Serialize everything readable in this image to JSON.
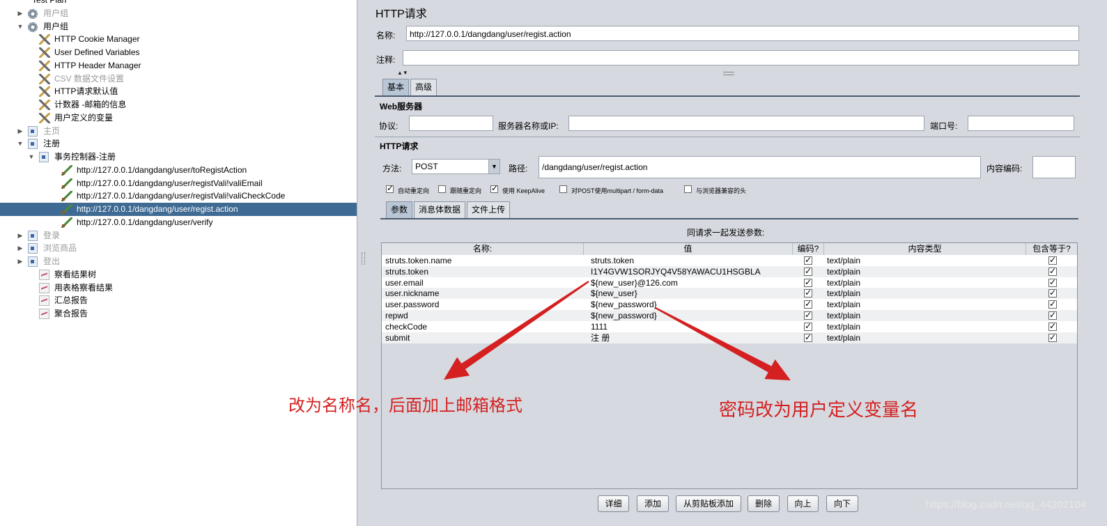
{
  "tree": {
    "items": [
      {
        "label": "Test Plan",
        "icon": "test-plan-icon",
        "toggle": "",
        "disabled": false,
        "selected": false
      },
      {
        "label": "用户组",
        "icon": "gear-icon",
        "toggle": "▶",
        "disabled": true,
        "selected": false
      },
      {
        "label": "用户组",
        "icon": "gear-icon",
        "toggle": "▼",
        "disabled": false,
        "selected": false
      },
      {
        "label": "HTTP Cookie Manager",
        "icon": "wrench-icon",
        "toggle": "",
        "disabled": false,
        "selected": false
      },
      {
        "label": "User Defined Variables",
        "icon": "wrench-icon",
        "toggle": "",
        "disabled": false,
        "selected": false
      },
      {
        "label": "HTTP Header Manager",
        "icon": "wrench-icon",
        "toggle": "",
        "disabled": false,
        "selected": false
      },
      {
        "label": "CSV 数据文件设置",
        "icon": "wrench-icon",
        "toggle": "",
        "disabled": true,
        "selected": false
      },
      {
        "label": "HTTP请求默认值",
        "icon": "wrench-icon",
        "toggle": "",
        "disabled": false,
        "selected": false
      },
      {
        "label": "计数器 -邮箱的信息",
        "icon": "wrench-icon",
        "toggle": "",
        "disabled": false,
        "selected": false
      },
      {
        "label": "用户定义的变量",
        "icon": "wrench-icon",
        "toggle": "",
        "disabled": false,
        "selected": false
      },
      {
        "label": "主页",
        "icon": "controller-icon",
        "toggle": "▶",
        "disabled": true,
        "selected": false
      },
      {
        "label": "注册",
        "icon": "controller-icon",
        "toggle": "▼",
        "disabled": false,
        "selected": false
      },
      {
        "label": "事务控制器-注册",
        "icon": "controller-icon",
        "toggle": "▼",
        "disabled": false,
        "selected": false
      },
      {
        "label": "http://127.0.0.1/dangdang/user/toRegistAction",
        "icon": "sampler-icon",
        "toggle": "",
        "disabled": false,
        "selected": false
      },
      {
        "label": "http://127.0.0.1/dangdang/user/registVali!valiEmail",
        "icon": "sampler-icon",
        "toggle": "",
        "disabled": false,
        "selected": false
      },
      {
        "label": "http://127.0.0.1/dangdang/user/registVali!valiCheckCode",
        "icon": "sampler-icon",
        "toggle": "",
        "disabled": false,
        "selected": false
      },
      {
        "label": "http://127.0.0.1/dangdang/user/regist.action",
        "icon": "sampler-icon",
        "toggle": "",
        "disabled": false,
        "selected": true
      },
      {
        "label": "http://127.0.0.1/dangdang/user/verify",
        "icon": "sampler-icon",
        "toggle": "",
        "disabled": false,
        "selected": false
      },
      {
        "label": "登录",
        "icon": "controller-icon",
        "toggle": "▶",
        "disabled": true,
        "selected": false
      },
      {
        "label": "浏览商品",
        "icon": "controller-icon",
        "toggle": "▶",
        "disabled": true,
        "selected": false
      },
      {
        "label": "登出",
        "icon": "controller-icon",
        "toggle": "▶",
        "disabled": true,
        "selected": false
      },
      {
        "label": "察看结果树",
        "icon": "listener-icon",
        "toggle": "",
        "disabled": false,
        "selected": false
      },
      {
        "label": "用表格察看结果",
        "icon": "listener-icon",
        "toggle": "",
        "disabled": false,
        "selected": false
      },
      {
        "label": "汇总报告",
        "icon": "listener-icon",
        "toggle": "",
        "disabled": false,
        "selected": false
      },
      {
        "label": "聚合报告",
        "icon": "listener-icon",
        "toggle": "",
        "disabled": false,
        "selected": false
      }
    ]
  },
  "panel": {
    "title": "HTTP请求",
    "name_label": "名称:",
    "name_value": "http://127.0.0.1/dangdang/user/regist.action",
    "comment_label": "注释:",
    "comment_value": "",
    "tabs": [
      "基本",
      "高级"
    ],
    "web_server": {
      "title": "Web服务器",
      "protocol_label": "协议:",
      "protocol_value": "",
      "server_label": "服务器名称或IP:",
      "server_value": "",
      "port_label": "端口号:",
      "port_value": ""
    },
    "http_request": {
      "title": "HTTP请求",
      "method_label": "方法:",
      "method_value": "POST",
      "path_label": "路径:",
      "path_value": "/dangdang/user/regist.action",
      "encoding_label": "内容编码:",
      "encoding_value": ""
    },
    "options": [
      {
        "label": "自动重定向",
        "checked": true
      },
      {
        "label": "跟随重定向",
        "checked": false
      },
      {
        "label": "使用 KeepAlive",
        "checked": true
      },
      {
        "label": "对POST使用multipart / form-data",
        "checked": false
      },
      {
        "label": "与浏览器兼容的头",
        "checked": false
      }
    ],
    "subtabs": [
      "参数",
      "消息体数据",
      "文件上传"
    ],
    "params_title": "同请求一起发送参数:",
    "columns": [
      "名称:",
      "值",
      "编码?",
      "内容类型",
      "包含等于?"
    ],
    "rows": [
      {
        "name": "struts.token.name",
        "value": "struts.token",
        "encode": true,
        "content_type": "text/plain",
        "include_equals": true
      },
      {
        "name": "struts.token",
        "value": "I1Y4GVW1SORJYQ4V58YAWACU1HSGBLA",
        "encode": true,
        "content_type": "text/plain",
        "include_equals": true
      },
      {
        "name": "user.email",
        "value": "${new_user}@126.com",
        "encode": true,
        "content_type": "text/plain",
        "include_equals": true
      },
      {
        "name": "user.nickname",
        "value": "${new_user}",
        "encode": true,
        "content_type": "text/plain",
        "include_equals": true
      },
      {
        "name": "user.password",
        "value": "${new_password}",
        "encode": true,
        "content_type": "text/plain",
        "include_equals": true
      },
      {
        "name": "repwd",
        "value": "${new_password}",
        "encode": true,
        "content_type": "text/plain",
        "include_equals": true
      },
      {
        "name": "checkCode",
        "value": "1111",
        "encode": true,
        "content_type": "text/plain",
        "include_equals": true
      },
      {
        "name": "submit",
        "value": "注 册",
        "encode": true,
        "content_type": "text/plain",
        "include_equals": true
      }
    ],
    "buttons": {
      "detail": "详细",
      "add": "添加",
      "add_clipboard": "从剪贴板添加",
      "delete": "删除",
      "up": "向上",
      "down": "向下"
    }
  },
  "annotations": {
    "left": "改为名称名，后面加上邮箱格式",
    "right": "密码改为用户定义变量名",
    "color": "#d42020"
  },
  "watermark": "https://blog.csdn.net/qq_44202104"
}
